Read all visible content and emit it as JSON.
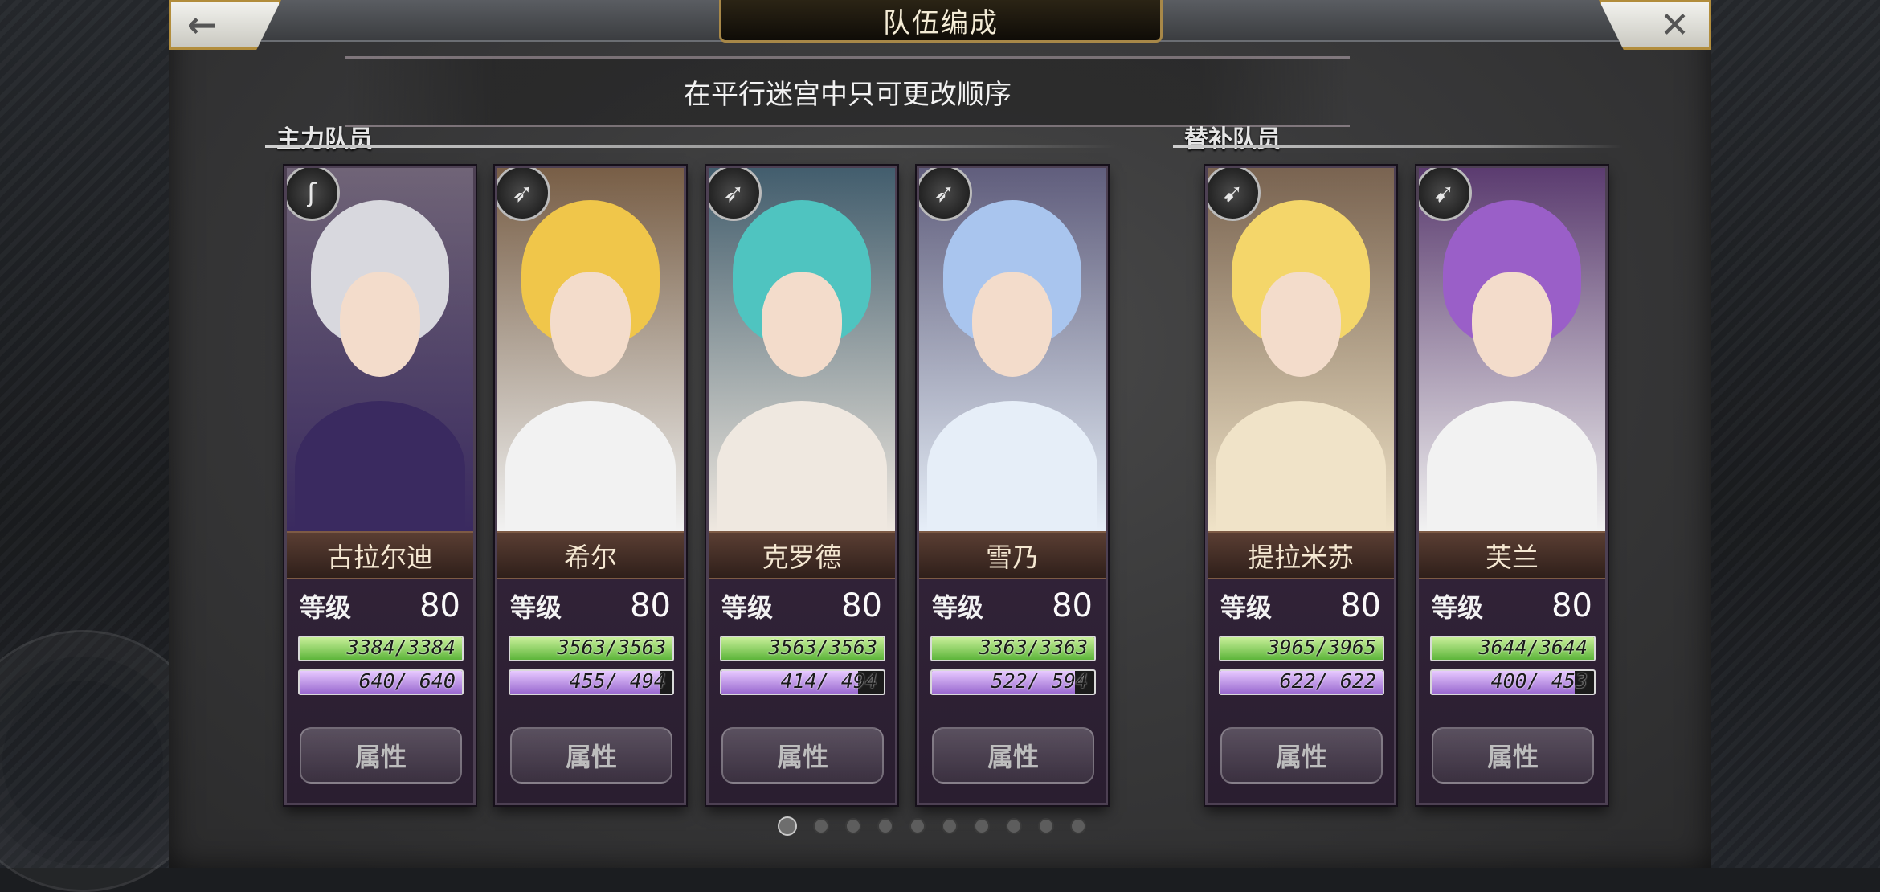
{
  "header": {
    "title": "队伍编成",
    "back_icon": "←",
    "close_icon": "✕"
  },
  "notice": "在平行迷宫中只可更改顺序",
  "sections": {
    "main_label": "主力队员",
    "sub_label": "替补队员"
  },
  "level_label": "等级",
  "attribute_label": "属性",
  "main_members": [
    {
      "name": "古拉尔迪",
      "class_icon": "staff-icon",
      "class_glyph": "ʃ",
      "level": "80",
      "hp": "3384/3384",
      "hp_ratio": 1.0,
      "mp": "640/ 640",
      "mp_ratio": 1.0,
      "hair": "#d8d8de",
      "body": "#3a2a60"
    },
    {
      "name": "希尔",
      "class_icon": "bow-icon",
      "class_glyph": "➶",
      "level": "80",
      "hp": "3563/3563",
      "hp_ratio": 1.0,
      "mp": "455/ 494",
      "mp_ratio": 0.92,
      "hair": "#f0c64a",
      "body": "#f2f2f2"
    },
    {
      "name": "克罗德",
      "class_icon": "bow-icon",
      "class_glyph": "➶",
      "level": "80",
      "hp": "3563/3563",
      "hp_ratio": 1.0,
      "mp": "414/ 494",
      "mp_ratio": 0.84,
      "hair": "#4fc4c0",
      "body": "#efe8e0"
    },
    {
      "name": "雪乃",
      "class_icon": "bow-icon",
      "class_glyph": "➶",
      "level": "80",
      "hp": "3363/3363",
      "hp_ratio": 1.0,
      "mp": "522/ 594",
      "mp_ratio": 0.88,
      "hair": "#a9c5ee",
      "body": "#e6eef8"
    }
  ],
  "sub_members": [
    {
      "name": "提拉米苏",
      "class_icon": "spear-icon",
      "class_glyph": "➹",
      "level": "80",
      "hp": "3965/3965",
      "hp_ratio": 1.0,
      "mp": "622/ 622",
      "mp_ratio": 1.0,
      "hair": "#f4d66a",
      "body": "#f0e3c8"
    },
    {
      "name": "芙兰",
      "class_icon": "spear-icon",
      "class_glyph": "➹",
      "level": "80",
      "hp": "3644/3644",
      "hp_ratio": 1.0,
      "mp": "400/ 453",
      "mp_ratio": 0.88,
      "hair": "#9a5fc8",
      "body": "#f2f2f2"
    }
  ],
  "pagination": {
    "total": 10,
    "active": 0
  }
}
